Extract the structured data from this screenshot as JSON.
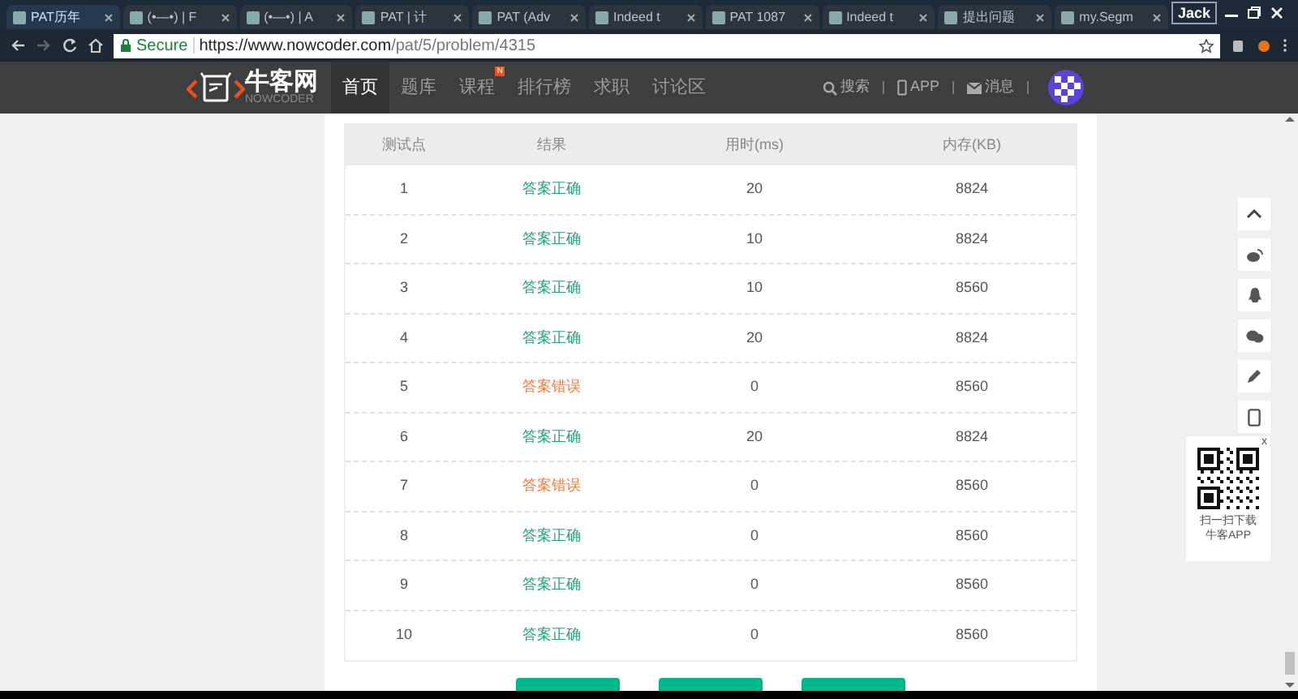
{
  "browser": {
    "tabs": [
      {
        "title": "PAT历年",
        "selected": true
      },
      {
        "title": "(•—•) | F",
        "selected": false
      },
      {
        "title": "(•—•) | A",
        "selected": false
      },
      {
        "title": "PAT | 计",
        "selected": false
      },
      {
        "title": "PAT (Adv",
        "selected": false
      },
      {
        "title": "Indeed t",
        "selected": false
      },
      {
        "title": "PAT 1087",
        "selected": false
      },
      {
        "title": "Indeed t",
        "selected": false
      },
      {
        "title": "提出问题",
        "selected": false
      },
      {
        "title": "my.Segm",
        "selected": false
      }
    ],
    "user": "Jack",
    "secure_label": "Secure",
    "url_host": "https://www.nowcoder.com",
    "url_path": "/pat/5/problem/4315"
  },
  "nav": {
    "logo": "牛客网",
    "logo_sub": "NOWCODER",
    "items": [
      {
        "label": "首页",
        "selected": true
      },
      {
        "label": "题库",
        "selected": false
      },
      {
        "label": "课程",
        "selected": false,
        "badge": "N"
      },
      {
        "label": "排行榜",
        "selected": false
      },
      {
        "label": "求职",
        "selected": false
      },
      {
        "label": "讨论区",
        "selected": false
      }
    ],
    "search": "搜索",
    "app": "APP",
    "messages": "消息"
  },
  "table": {
    "columns": [
      "测试点",
      "结果",
      "用时(ms)",
      "内存(KB)"
    ],
    "rows": [
      {
        "case": "1",
        "result": "答案正确",
        "kind": "pass",
        "time": "20",
        "memory": "8824"
      },
      {
        "case": "2",
        "result": "答案正确",
        "kind": "pass",
        "time": "10",
        "memory": "8824"
      },
      {
        "case": "3",
        "result": "答案正确",
        "kind": "pass",
        "time": "10",
        "memory": "8560"
      },
      {
        "case": "4",
        "result": "答案正确",
        "kind": "pass",
        "time": "20",
        "memory": "8824"
      },
      {
        "case": "5",
        "result": "答案错误",
        "kind": "fail",
        "time": "0",
        "memory": "8560"
      },
      {
        "case": "6",
        "result": "答案正确",
        "kind": "pass",
        "time": "20",
        "memory": "8824"
      },
      {
        "case": "7",
        "result": "答案错误",
        "kind": "fail",
        "time": "0",
        "memory": "8560"
      },
      {
        "case": "8",
        "result": "答案正确",
        "kind": "pass",
        "time": "0",
        "memory": "8560"
      },
      {
        "case": "9",
        "result": "答案正确",
        "kind": "pass",
        "time": "0",
        "memory": "8560"
      },
      {
        "case": "10",
        "result": "答案正确",
        "kind": "pass",
        "time": "0",
        "memory": "8560"
      }
    ]
  },
  "qr": {
    "caption": [
      "扫一扫下载",
      "牛客APP"
    ],
    "close": "x"
  }
}
